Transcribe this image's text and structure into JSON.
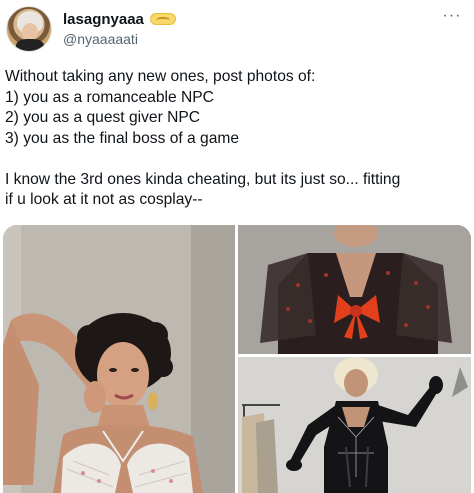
{
  "user": {
    "display_name": "lasagnyaaa",
    "handle": "@nyaaaaati",
    "badge_icon": "gold-pill-badge",
    "more_icon": "ellipsis-icon",
    "more_glyph": "···"
  },
  "tweet": {
    "lines": [
      "Without taking any new ones, post photos of:",
      "1) you as a romanceable NPC",
      "2) you as a quest giver NPC",
      "3) you as the final boss of a game",
      "",
      "I know the 3rd ones kinda cheating,  but its just so... fitting",
      "if u look at it not as cosplay--"
    ]
  },
  "media": {
    "photos": [
      {
        "id": "photo-portrait-curly-hair"
      },
      {
        "id": "photo-black-kimono-red-bow"
      },
      {
        "id": "photo-black-latex-cosplay"
      }
    ]
  },
  "colors": {
    "text": "#0f1419",
    "secondary": "#536471",
    "badge": "#f7d86b",
    "bow_red": "#e2401c"
  }
}
